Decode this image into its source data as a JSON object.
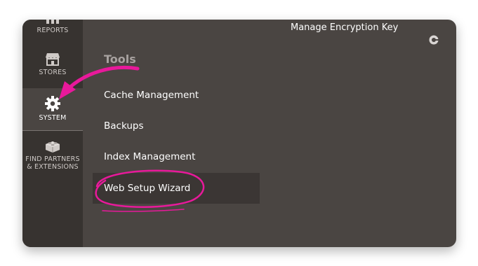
{
  "sidebar": {
    "items": [
      {
        "label": "REPORTS",
        "icon": "bar-chart-icon"
      },
      {
        "label": "STORES",
        "icon": "storefront-icon"
      },
      {
        "label": "SYSTEM",
        "icon": "gear-icon",
        "active": true
      },
      {
        "label": "FIND PARTNERS & EXTENSIONS",
        "label_line1": "FIND PARTNERS",
        "label_line2": "& EXTENSIONS",
        "icon": "lego-brick-icon"
      }
    ]
  },
  "header": {
    "link": "Manage Encryption Key",
    "icon": "close-circle-icon"
  },
  "main": {
    "section_title": "Tools",
    "items": [
      {
        "label": "Cache Management"
      },
      {
        "label": "Backups"
      },
      {
        "label": "Index Management"
      },
      {
        "label": "Web Setup Wizard",
        "highlighted": true
      }
    ]
  },
  "annotations": {
    "arrow_color": "#e8199b",
    "circle_color": "#e8199b"
  },
  "colors": {
    "sidebar_bg": "#373330",
    "content_bg": "#4a4542",
    "active_item_bg": "#4a4542",
    "hover_item_bg": "#3b3634",
    "section_title": "#a8a2a0",
    "text": "#ffffff"
  }
}
